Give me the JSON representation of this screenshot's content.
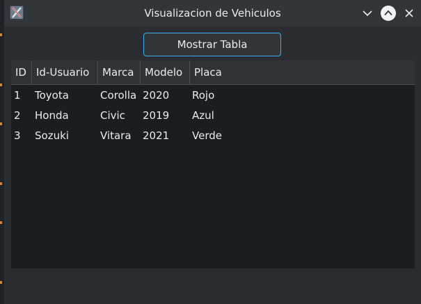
{
  "window": {
    "title": "Visualizacion de Vehiculos"
  },
  "toolbar": {
    "show_table_label": "Mostrar Tabla"
  },
  "table": {
    "headers": [
      "ID",
      "Id-Usuario",
      "Marca",
      "Modelo",
      "Placa"
    ],
    "rows": [
      [
        "1",
        "Toyota",
        "Corolla",
        "2020",
        "Rojo"
      ],
      [
        "2",
        "Honda",
        "Civic",
        "2019",
        "Azul"
      ],
      [
        "3",
        "Sozuki",
        "Vitara",
        "2021",
        "Verde"
      ]
    ]
  },
  "colors": {
    "accent": "#3daee9",
    "window_bg": "#2a2e32",
    "table_bg": "#1b1e20"
  }
}
